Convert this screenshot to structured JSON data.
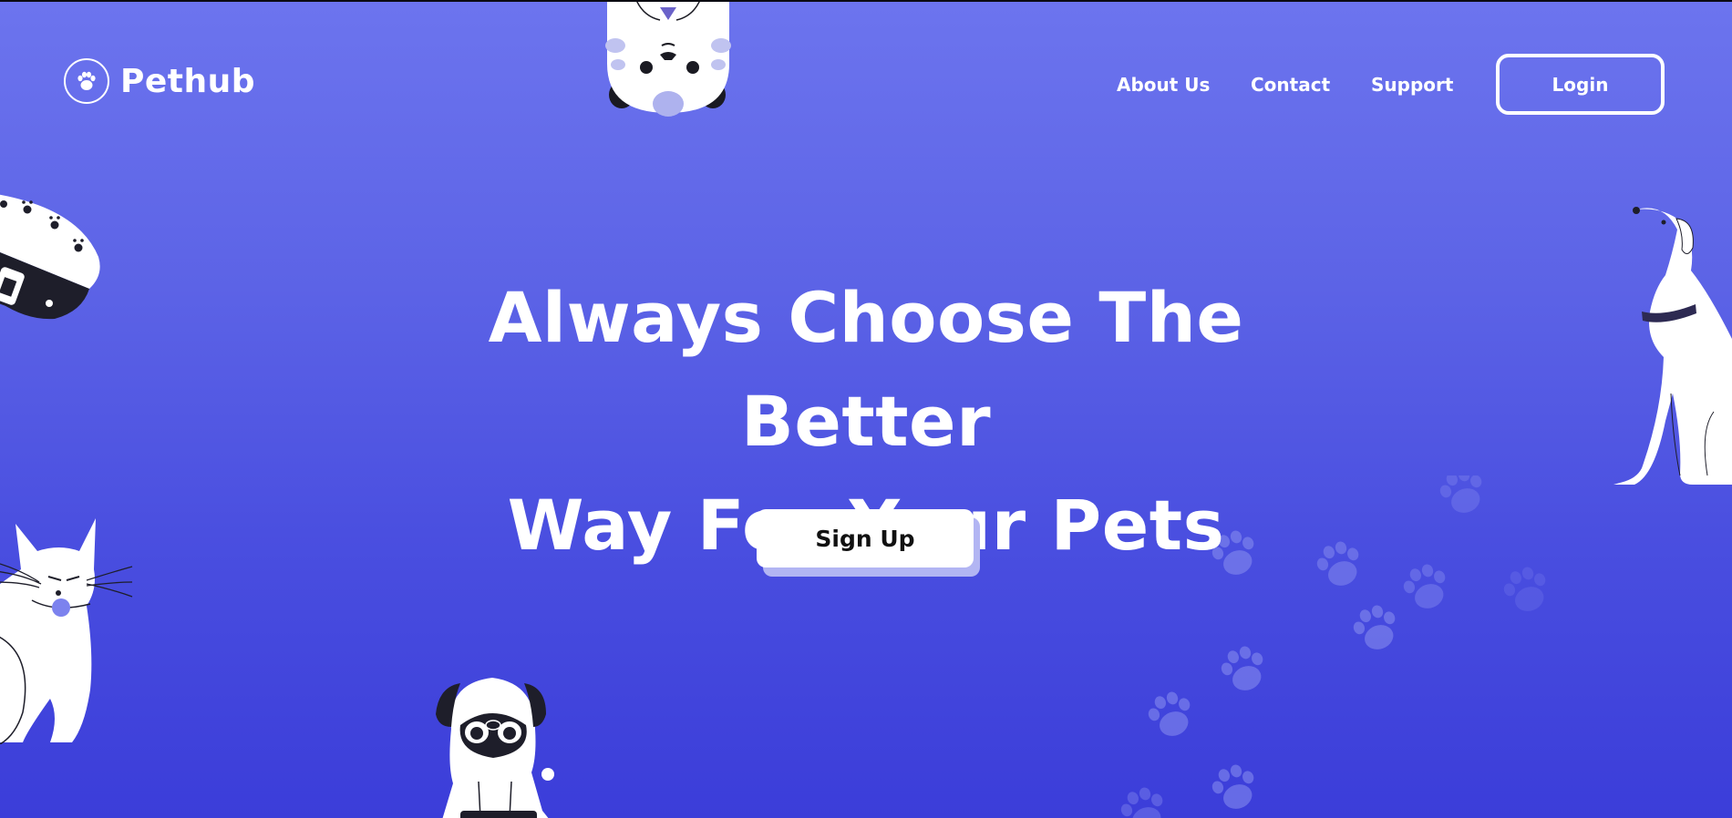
{
  "brand": {
    "name": "Pethub",
    "icon": "paw-icon"
  },
  "nav": {
    "links": [
      "About Us",
      "Contact",
      "Support"
    ],
    "login_label": "Login"
  },
  "hero": {
    "title_line1": "Always Choose The Better",
    "title_line2": "Way For Your Pets",
    "cta_label": "Sign Up"
  },
  "colors": {
    "background_top": "#6c74ee",
    "background_bottom": "#3b3dd9",
    "cta_shadow": "#b2b5f3",
    "text": "#ffffff"
  },
  "illustrations": [
    "cat-hanging-illustration",
    "collar-illustration",
    "dog-sitting-illustration",
    "cat-sitting-illustration",
    "pug-illustration",
    "paw-prints-decoration"
  ]
}
